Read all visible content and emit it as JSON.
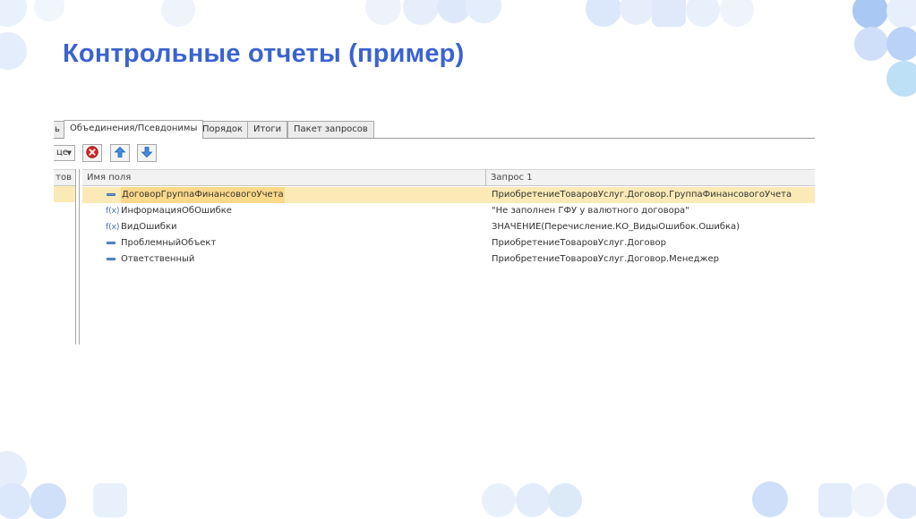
{
  "slide": {
    "title": "Контрольные отчеты (пример)"
  },
  "tabs": [
    {
      "label": "ь"
    },
    {
      "label": "Объединения/Псевдонимы",
      "active": true
    },
    {
      "label": "Порядок"
    },
    {
      "label": "Итоги"
    },
    {
      "label": "Пакет запросов"
    }
  ],
  "toolbar": {
    "dropdown_value": "це",
    "delete_icon": "delete-icon",
    "up_icon": "arrow-up-icon",
    "down_icon": "arrow-down-icon"
  },
  "left_panel": {
    "header": "тов"
  },
  "grid": {
    "columns": [
      "Имя поля",
      "Запрос 1"
    ],
    "rows": [
      {
        "icon": "field-icon",
        "name": "ДоговорГруппаФинансовогоУчета",
        "value": "ПриобретениеТоваровУслуг.Договор.ГруппаФинансовогоУчета",
        "selected": true
      },
      {
        "icon": "function-icon",
        "icon_text": "f(x)",
        "name": "ИнформацияОбОшибке",
        "value": "\"Не заполнен ГФУ у валютного договора\""
      },
      {
        "icon": "function-icon",
        "icon_text": "f(x)",
        "name": "ВидОшибки",
        "value": "ЗНАЧЕНИЕ(Перечисление.КО_ВидыОшибок.Ошибка)"
      },
      {
        "icon": "field-icon",
        "name": "ПроблемныйОбъект",
        "value": "ПриобретениеТоваровУслуг.Договор"
      },
      {
        "icon": "field-icon",
        "name": "Ответственный",
        "value": "ПриобретениеТоваровУслуг.Договор.Менеджер"
      }
    ]
  },
  "colors": {
    "title": "#3a63cf",
    "selected_row": "#fbeab6",
    "decor_blue": "#c9dcf7"
  }
}
